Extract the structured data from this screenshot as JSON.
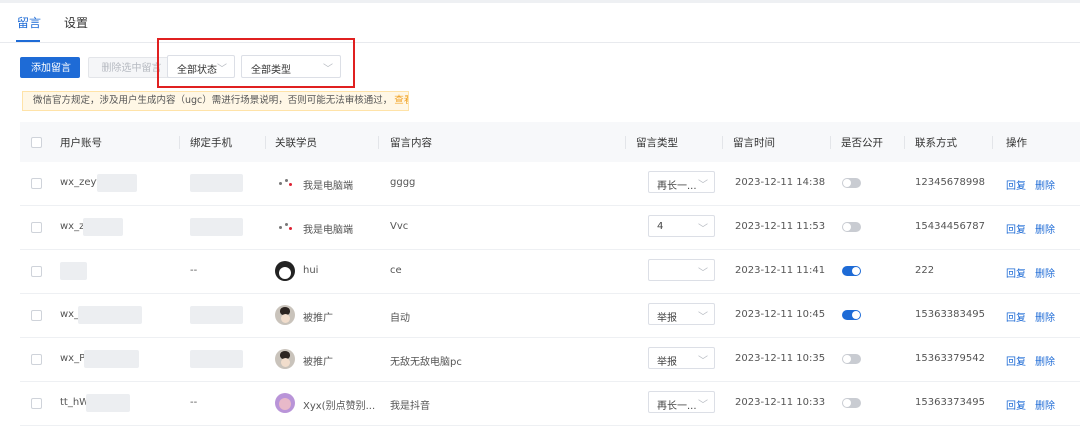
{
  "tabs": [
    {
      "label": "留言",
      "active": true
    },
    {
      "label": "设置",
      "active": false
    }
  ],
  "toolbar": {
    "add_label": "添加留言",
    "delete_selected_label": "删除选中留言"
  },
  "filters": {
    "status_selected": "全部状态",
    "type_selected": "全部类型"
  },
  "notice": {
    "text": "微信官方规定，涉及用户生成内容（ugc）需进行场景说明，否则可能无法审核通过，",
    "link": "查看教程"
  },
  "columns": [
    "用户账号",
    "绑定手机",
    "关联学员",
    "留言内容",
    "留言类型",
    "留言时间",
    "是否公开",
    "联系方式",
    "操作"
  ],
  "rows": [
    {
      "account": "wx_zeyf",
      "phone": "",
      "student": "我是电脑端",
      "avatar": "dots-icon",
      "content": "gggg",
      "type": "再长一...",
      "time": "2023-12-11 14:38",
      "public": false,
      "contact": "12345678998"
    },
    {
      "account": "wx_z",
      "phone": "",
      "student": "我是电脑端",
      "avatar": "dots-icon",
      "content": "Vvc",
      "type": "4",
      "time": "2023-12-11 11:53",
      "public": false,
      "contact": "15434456787"
    },
    {
      "account": "",
      "phone": "--",
      "student": "hui",
      "avatar": "penguin-icon",
      "content": "ce",
      "type": "",
      "time": "2023-12-11 11:41",
      "public": true,
      "contact": "222"
    },
    {
      "account": "wx_",
      "phone": "",
      "student": "被推广",
      "avatar": "photo-icon",
      "content": "自动",
      "type": "举报",
      "time": "2023-12-11 10:45",
      "public": true,
      "contact": "15363383495"
    },
    {
      "account": "wx_P",
      "phone": "",
      "student": "被推广",
      "avatar": "photo-icon",
      "content": "无敌无敌电脑pc",
      "type": "举报",
      "time": "2023-12-11 10:35",
      "public": false,
      "contact": "15363379542"
    },
    {
      "account": "tt_hW",
      "phone": "--",
      "student": "Xyx(别点赞别...",
      "avatar": "purple-avatar-icon",
      "content": "我是抖音",
      "type": "再长一...",
      "time": "2023-12-11 10:33",
      "public": false,
      "contact": "15363373495"
    }
  ],
  "actions": {
    "reply": "回复",
    "delete": "删除"
  },
  "colors": {
    "accent": "#1e6bd6",
    "highlight": "#e02020",
    "notice_link": "#f0a020"
  }
}
